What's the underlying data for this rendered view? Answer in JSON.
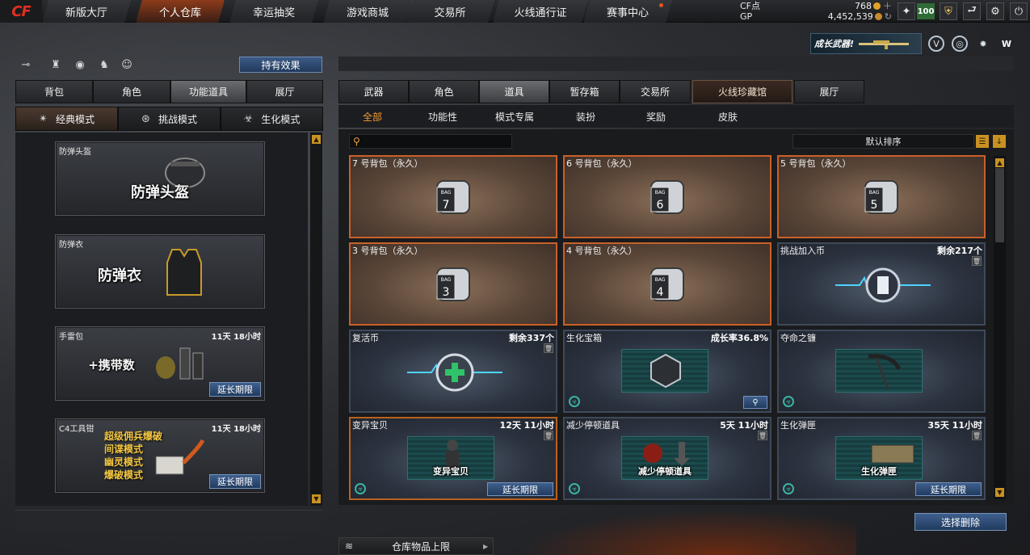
{
  "logo": "CF",
  "nav": {
    "tabs": [
      {
        "label": "新版大厅"
      },
      {
        "label": "个人仓库"
      },
      {
        "label": "幸运抽奖"
      },
      {
        "label": "游戏商城"
      },
      {
        "label": "交易所"
      },
      {
        "label": "火线通行证"
      },
      {
        "label": "赛事中心"
      }
    ],
    "active": "个人仓库"
  },
  "currency": {
    "cf_label": "CF点",
    "cf_value": "768",
    "gp_label": "GP",
    "gp_value": "4,452,539"
  },
  "level": "100",
  "grow_banner": "成长武器!",
  "left": {
    "effect_button": "持有效果",
    "tabs": [
      "背包",
      "角色",
      "功能道具",
      "展厅"
    ],
    "active_tab": "功能道具",
    "mode_tabs": [
      "经典模式",
      "挑战模式",
      "生化模式"
    ],
    "active_mode": "经典模式",
    "items": [
      {
        "name": "防弹头盔",
        "big": "防弹头盔",
        "time": ""
      },
      {
        "name": "防弹衣",
        "big": "防弹衣",
        "time": ""
      },
      {
        "name": "手雷包",
        "big": "+携带数",
        "time": "11天 18小时",
        "button": "延长期限"
      },
      {
        "name": "C4工具钳",
        "lines": [
          "超级佣兵爆破",
          "间谍模式",
          "幽灵模式",
          "爆破模式"
        ],
        "time": "11天 18小时",
        "button": "延长期限"
      }
    ]
  },
  "right": {
    "tabs": [
      "武器",
      "角色",
      "道具",
      "暂存箱",
      "交易所",
      "火线珍藏馆",
      "展厅"
    ],
    "active_tab": "道具",
    "subtabs": [
      "全部",
      "功能性",
      "模式专属",
      "装扮",
      "奖励",
      "皮肤"
    ],
    "active_subtab": "全部",
    "sort_label": "默认排序",
    "cards": [
      {
        "name": "7 号背包（永久）",
        "info": "",
        "bag": "7"
      },
      {
        "name": "6 号背包（永久）",
        "info": "",
        "bag": "6"
      },
      {
        "name": "5 号背包（永久）",
        "info": "",
        "bag": "5"
      },
      {
        "name": "3 号背包（永久）",
        "info": "",
        "bag": "3"
      },
      {
        "name": "4 号背包（永久）",
        "info": "",
        "bag": "4"
      },
      {
        "name": "挑战加入币",
        "info": "剩余217个"
      },
      {
        "name": "复活币",
        "info": "剩余337个"
      },
      {
        "name": "生化宝箱",
        "info": "成长率36.8%"
      },
      {
        "name": "夺命之镰",
        "info": ""
      },
      {
        "name": "变异宝贝",
        "info": "12天 11小时",
        "image_label": "变异宝贝",
        "button": "延长期限"
      },
      {
        "name": "减少停顿道具",
        "info": "5天 11小时",
        "image_label": "减少停顿道具"
      },
      {
        "name": "生化弹匣",
        "info": "35天 11小时",
        "image_label": "生化弹匣",
        "button": "延长期限"
      }
    ],
    "delete_button": "选择删除",
    "storage_label": "仓库物品上限"
  },
  "icons": {
    "bag_label": "BAG",
    "accent": "#f29a2e",
    "card_border_orange": "#c9602a",
    "button_blue": "#2e4c74"
  }
}
